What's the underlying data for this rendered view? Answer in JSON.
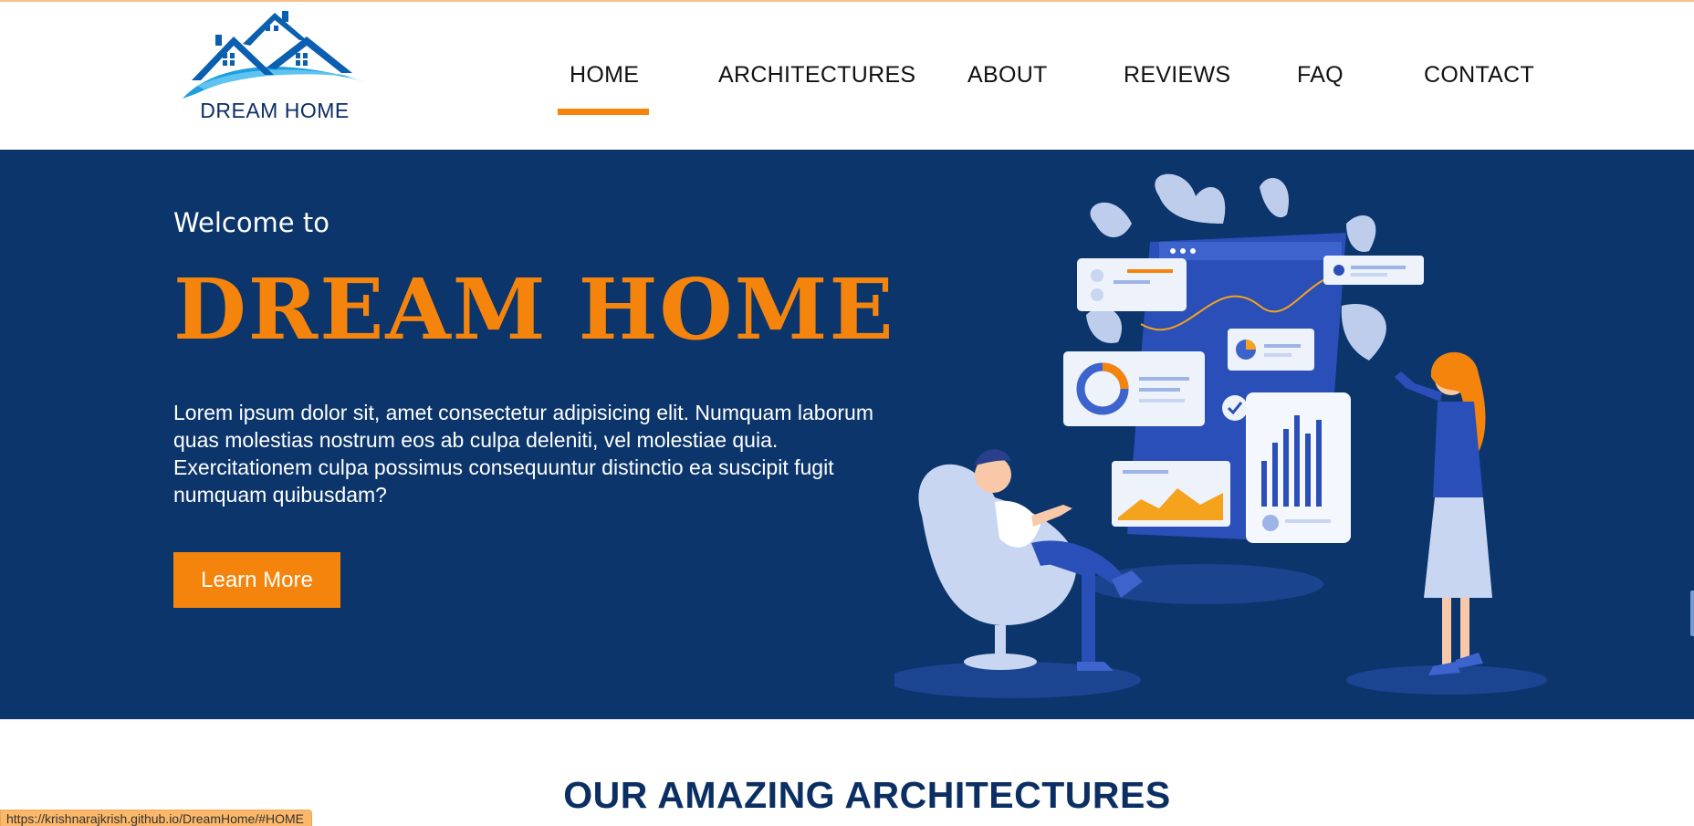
{
  "brand": {
    "logo_text": "DREAM HOME",
    "primary_color": "#0b356b",
    "accent_color": "#f5840c"
  },
  "nav": {
    "active": "HOME",
    "items": [
      {
        "label": "HOME"
      },
      {
        "label": "ARCHITECTURES"
      },
      {
        "label": "ABOUT"
      },
      {
        "label": "REVIEWS"
      },
      {
        "label": "FAQ"
      },
      {
        "label": "CONTACT"
      }
    ]
  },
  "hero": {
    "welcome": "Welcome to",
    "title": "DREAM HOME",
    "text": "Lorem ipsum dolor sit, amet consectetur adipisicing elit. Numquam laborum quas molestias nostrum eos ab culpa deleniti, vel molestiae quia. Exercitationem culpa possimus consequuntur distinctio ea suscipit fugit numquam quibusdam?",
    "button_label": "Learn More"
  },
  "section": {
    "title": "OUR AMAZING ARCHITECTURES"
  },
  "status_bar": {
    "url": "https://krishnarajkrish.github.io/DreamHome/#HOME"
  }
}
